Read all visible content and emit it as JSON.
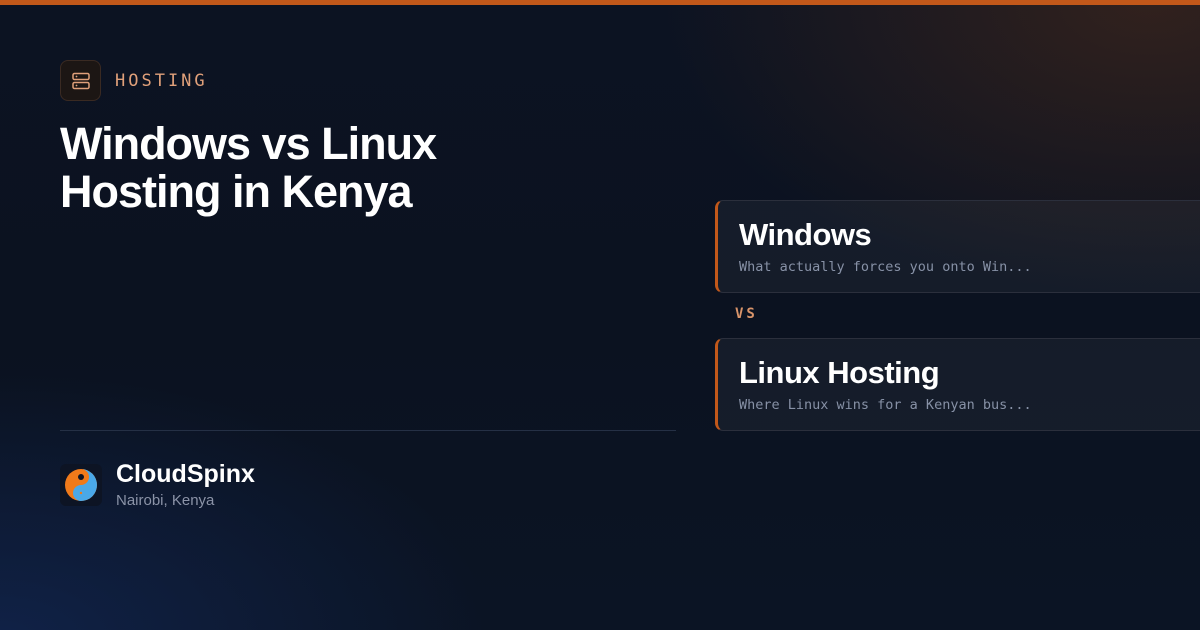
{
  "colors": {
    "accent": "#c2581a",
    "category_text": "#e0a07a",
    "background": "#0b1120",
    "muted_text": "#8b93a7"
  },
  "category": {
    "icon": "server-icon",
    "label": "HOSTING"
  },
  "title": {
    "line1": "Windows vs Linux",
    "line2": "Hosting in Kenya"
  },
  "comparison": {
    "vs_label": "VS",
    "items": [
      {
        "title": "Windows",
        "description": "What actually forces you onto Win..."
      },
      {
        "title": "Linux Hosting",
        "description": "Where Linux wins for a Kenyan bus..."
      }
    ]
  },
  "brand": {
    "logo_icon": "cloudspinx-logo-icon",
    "name": "CloudSpinx",
    "location": "Nairobi, Kenya"
  }
}
